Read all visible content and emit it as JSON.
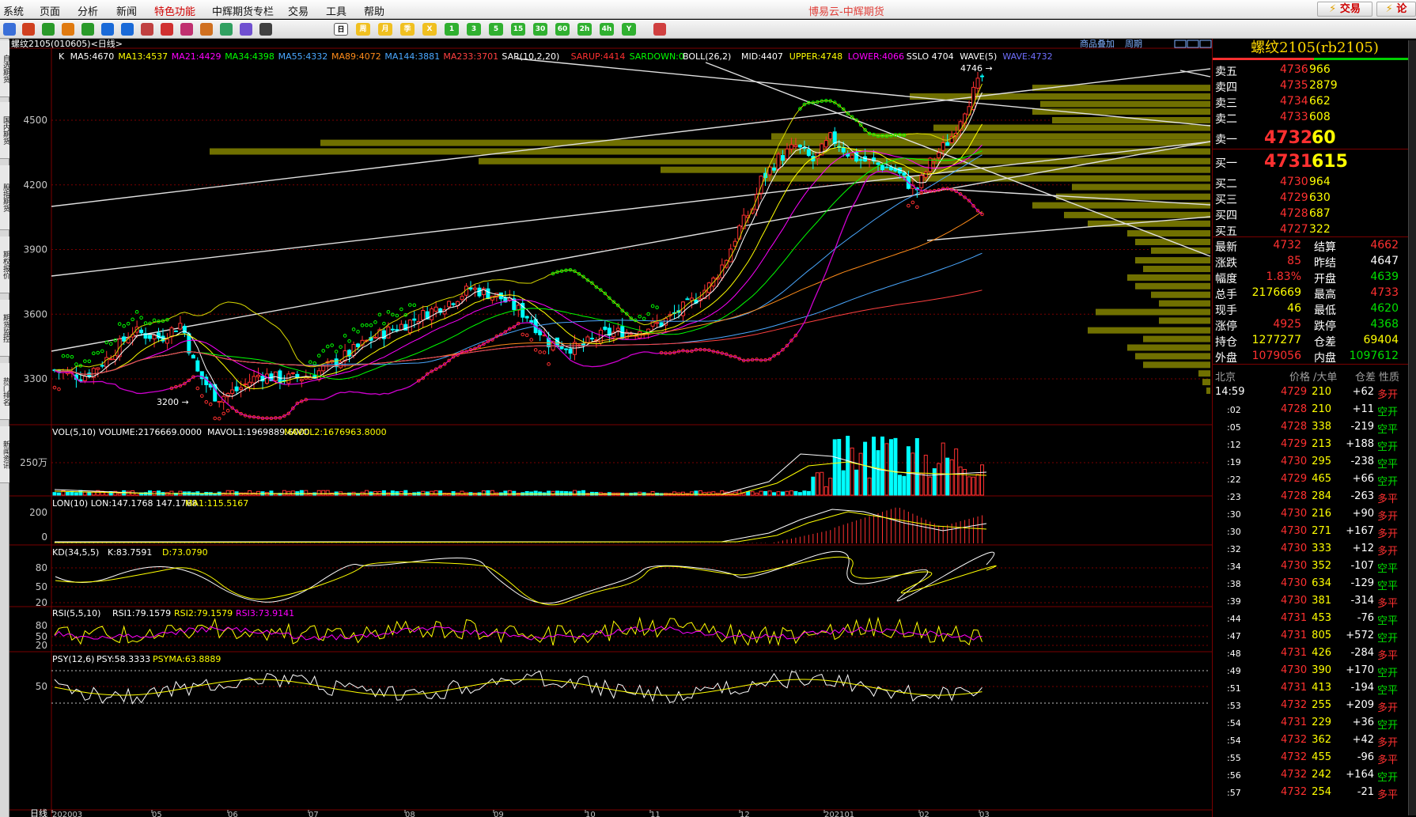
{
  "menu": [
    "系统",
    "页面",
    "分析",
    "新闻",
    "特色功能",
    "中辉期货专栏",
    "交易",
    "工具",
    "帮助"
  ],
  "app_title": "博易云-中辉期货",
  "top_buttons": {
    "trade": "交易",
    "forum": "论"
  },
  "toolbar_icons": [
    "back-icon",
    "home-icon",
    "refresh-icon",
    "news-icon",
    "recycle-icon",
    "search-icon",
    "search2-icon",
    "window-icon",
    "pen-icon",
    "chart-icon",
    "rocket-icon",
    "pin-icon",
    "draw-icon",
    "table-icon",
    "kline-icon",
    "tick-icon",
    "day-icon",
    "week-icon",
    "month-icon",
    "season-icon",
    "x-icon",
    "1min-icon",
    "3min-icon",
    "5min-icon",
    "15min-icon",
    "30min-icon",
    "60min-icon",
    "2h-icon",
    "4h-icon",
    "y-icon",
    "calc-icon"
  ],
  "toolbar_labels": [
    "日",
    "周",
    "月",
    "季",
    "X",
    "1",
    "3",
    "5",
    "15",
    "30",
    "60",
    "2h",
    "4h",
    "Y"
  ],
  "sidebar_tabs": [
    "自选期货",
    "国内期货",
    "股指期货",
    "期权报价",
    "期货监控",
    "热门排名",
    "新闻资讯"
  ],
  "chart_header": {
    "title": "螺纹2105(010605)<日线>",
    "link1": "商品叠加",
    "link2": "周期"
  },
  "main_indicators": [
    {
      "text": "K",
      "color": "#ffffff"
    },
    {
      "text": "MA5:4670",
      "color": "#ffffff"
    },
    {
      "text": "MA13:4537",
      "color": "#ffff00"
    },
    {
      "text": "MA21:4429",
      "color": "#ff00ff"
    },
    {
      "text": "MA34:4398",
      "color": "#00ff00"
    },
    {
      "text": "MA55:4332",
      "color": "#4aa8ff"
    },
    {
      "text": "MA89:4072",
      "color": "#ff8c1a"
    },
    {
      "text": "MA144:3881",
      "color": "#4aa8ff"
    },
    {
      "text": "MA233:3701",
      "color": "#ff4040"
    },
    {
      "text": "SAR(10,2,20)",
      "color": "#ffffff"
    },
    {
      "text": "SARUP:4414",
      "color": "#ff3030"
    },
    {
      "text": "SARDOWN:0",
      "color": "#00ff00"
    },
    {
      "text": "BOLL(26,2)",
      "color": "#ffffff"
    },
    {
      "text": "MID:4407",
      "color": "#ffffff"
    },
    {
      "text": "UPPER:4748",
      "color": "#ffff00"
    },
    {
      "text": "LOWER:4066",
      "color": "#ff00ff"
    },
    {
      "text": "SSLO 4704",
      "color": "#ffffff"
    },
    {
      "text": "WAVE(5)",
      "color": "#ffffff"
    },
    {
      "text": "WAVE:4732",
      "color": "#7070ff"
    }
  ],
  "main_yaxis": [
    "4500",
    "4200",
    "3900",
    "3600",
    "3300"
  ],
  "annotations": {
    "high": "4746",
    "low": "3200"
  },
  "vol_panel": {
    "header": "VOL(5,10) VOLUME:2176669.0000",
    "mavol1": "MAVOL1:1969889.6000",
    "mavol2": "MAVOL2:1676963.8000",
    "yaxis": "250万"
  },
  "lon_panel": {
    "header": "LON(10) LON:147.1768 147.1768",
    "ma1": "MA1:115.5167",
    "yaxis": [
      "200",
      "0"
    ]
  },
  "kd_panel": {
    "header": "KD(34,5,5)",
    "k": "K:83.7591",
    "d": "D:73.0790",
    "yaxis": [
      "80",
      "50",
      "20"
    ]
  },
  "rsi_panel": {
    "header": "RSI(5,5,10)",
    "rsi1": "RSI1:79.1579",
    "rsi2": "RSI2:79.1579",
    "rsi3": "RSI3:73.9141",
    "yaxis": [
      "80",
      "50",
      "20"
    ]
  },
  "psy_panel": {
    "header": "PSY(12,6)",
    "psy": "PSY:58.3333",
    "psyma": "PSYMA:63.8889",
    "yaxis": [
      "50"
    ]
  },
  "xaxis": {
    "label": "日线",
    "ticks": [
      "202003",
      "05",
      "06",
      "07",
      "08",
      "09",
      "10",
      "11",
      "12",
      "202101",
      "02",
      "03"
    ]
  },
  "quote": {
    "title": "螺纹2105(rb2105)",
    "asks": [
      {
        "label": "卖五",
        "price": "4736",
        "vol": "966"
      },
      {
        "label": "卖四",
        "price": "4735",
        "vol": "2879"
      },
      {
        "label": "卖三",
        "price": "4734",
        "vol": "662"
      },
      {
        "label": "卖二",
        "price": "4733",
        "vol": "608"
      },
      {
        "label": "卖一",
        "price": "4732",
        "vol": "60"
      }
    ],
    "bids": [
      {
        "label": "买一",
        "price": "4731",
        "vol": "615"
      },
      {
        "label": "买二",
        "price": "4730",
        "vol": "964"
      },
      {
        "label": "买三",
        "price": "4729",
        "vol": "630"
      },
      {
        "label": "买四",
        "price": "4728",
        "vol": "687"
      },
      {
        "label": "买五",
        "price": "4727",
        "vol": "322"
      }
    ],
    "stats": [
      {
        "l1": "最新",
        "v1": "4732",
        "c1": "#ff3030",
        "l2": "结算",
        "v2": "4662",
        "c2": "#ff3030"
      },
      {
        "l1": "涨跌",
        "v1": "85",
        "c1": "#ff3030",
        "l2": "昨结",
        "v2": "4647",
        "c2": "#ffffff"
      },
      {
        "l1": "幅度",
        "v1": "1.83%",
        "c1": "#ff3030",
        "l2": "开盘",
        "v2": "4639",
        "c2": "#00e000"
      },
      {
        "l1": "总手",
        "v1": "2176669",
        "c1": "#ffff00",
        "l2": "最高",
        "v2": "4733",
        "c2": "#ff3030"
      },
      {
        "l1": "现手",
        "v1": "46",
        "c1": "#ffff00",
        "l2": "最低",
        "v2": "4620",
        "c2": "#00e000"
      },
      {
        "l1": "涨停",
        "v1": "4925",
        "c1": "#ff3030",
        "l2": "跌停",
        "v2": "4368",
        "c2": "#00e000"
      },
      {
        "l1": "持仓",
        "v1": "1277277",
        "c1": "#ffff00",
        "l2": "仓差",
        "v2": "69404",
        "c2": "#ffff00"
      },
      {
        "l1": "外盘",
        "v1": "1079056",
        "c1": "#ff3030",
        "l2": "内盘",
        "v2": "1097612",
        "c2": "#00e000"
      }
    ],
    "tick_header": [
      "北京",
      "价格",
      "/大单",
      "仓差",
      "性质"
    ],
    "ticks": [
      {
        "t": "14:59",
        "p": "4729",
        "v": "210",
        "d": "+62",
        "n": "多开"
      },
      {
        "t": ":02",
        "p": "4728",
        "v": "210",
        "d": "+11",
        "n": "空开"
      },
      {
        "t": ":05",
        "p": "4728",
        "v": "338",
        "d": "-219",
        "n": "空平"
      },
      {
        "t": ":12",
        "p": "4729",
        "v": "213",
        "d": "+188",
        "n": "空开"
      },
      {
        "t": ":19",
        "p": "4730",
        "v": "295",
        "d": "-238",
        "n": "空平"
      },
      {
        "t": ":22",
        "p": "4729",
        "v": "465",
        "d": "+66",
        "n": "空开"
      },
      {
        "t": ":23",
        "p": "4728",
        "v": "284",
        "d": "-263",
        "n": "多平"
      },
      {
        "t": ":30",
        "p": "4730",
        "v": "216",
        "d": "+90",
        "n": "多开"
      },
      {
        "t": ":30",
        "p": "4730",
        "v": "271",
        "d": "+167",
        "n": "多开"
      },
      {
        "t": ":32",
        "p": "4730",
        "v": "333",
        "d": "+12",
        "n": "多开"
      },
      {
        "t": ":34",
        "p": "4730",
        "v": "352",
        "d": "-107",
        "n": "空平"
      },
      {
        "t": ":38",
        "p": "4730",
        "v": "634",
        "d": "-129",
        "n": "空平"
      },
      {
        "t": ":39",
        "p": "4730",
        "v": "381",
        "d": "-314",
        "n": "多平"
      },
      {
        "t": ":44",
        "p": "4731",
        "v": "453",
        "d": "-76",
        "n": "空平"
      },
      {
        "t": ":47",
        "p": "4731",
        "v": "805",
        "d": "+572",
        "n": "空开"
      },
      {
        "t": ":48",
        "p": "4731",
        "v": "426",
        "d": "-284",
        "n": "多平"
      },
      {
        "t": ":49",
        "p": "4730",
        "v": "390",
        "d": "+170",
        "n": "空开"
      },
      {
        "t": ":51",
        "p": "4731",
        "v": "413",
        "d": "-194",
        "n": "空平"
      },
      {
        "t": ":53",
        "p": "4732",
        "v": "255",
        "d": "+209",
        "n": "多开"
      },
      {
        "t": ":54",
        "p": "4731",
        "v": "229",
        "d": "+36",
        "n": "空开"
      },
      {
        "t": ":54",
        "p": "4732",
        "v": "362",
        "d": "+42",
        "n": "多开"
      },
      {
        "t": ":55",
        "p": "4732",
        "v": "455",
        "d": "-96",
        "n": "多平"
      },
      {
        "t": ":56",
        "p": "4732",
        "v": "242",
        "d": "+164",
        "n": "空开"
      },
      {
        "t": ":57",
        "p": "4732",
        "v": "254",
        "d": "-21",
        "n": "多平"
      }
    ]
  },
  "colors": {
    "up": "#ff3030",
    "down": "#00ffff",
    "bg": "#000000",
    "grid": "#7a0000",
    "yellow": "#ffff00",
    "green": "#00e000"
  }
}
